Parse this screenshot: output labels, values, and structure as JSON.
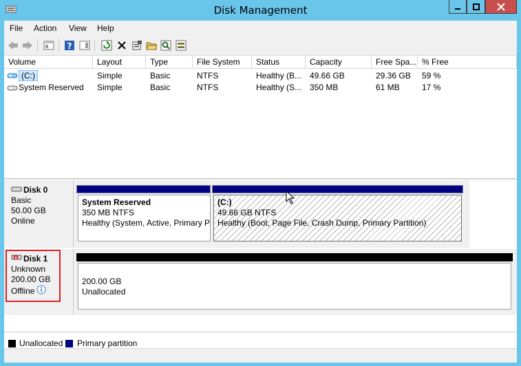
{
  "window": {
    "title": "Disk Management"
  },
  "menu": [
    {
      "label": "File"
    },
    {
      "label": "Action"
    },
    {
      "label": "View"
    },
    {
      "label": "Help"
    }
  ],
  "volume_list": {
    "columns": [
      "Volume",
      "Layout",
      "Type",
      "File System",
      "Status",
      "Capacity",
      "Free Spa...",
      "% Free"
    ],
    "rows": [
      {
        "volume": "(C:)",
        "layout": "Simple",
        "type": "Basic",
        "fs": "NTFS",
        "status": "Healthy (B...",
        "capacity": "49.66 GB",
        "free": "29.36 GB",
        "pct": "59 %"
      },
      {
        "volume": "System Reserved",
        "layout": "Simple",
        "type": "Basic",
        "fs": "NTFS",
        "status": "Healthy (S...",
        "capacity": "350 MB",
        "free": "61 MB",
        "pct": "17 %"
      }
    ]
  },
  "disks": [
    {
      "name": "Disk 0",
      "kind": "Basic",
      "size": "50.00 GB",
      "state": "Online",
      "partitions": [
        {
          "name": "System Reserved",
          "size": "350 MB NTFS",
          "status": "Healthy (System, Active, Primary P"
        },
        {
          "name": "(C:)",
          "size": "49.66 GB NTFS",
          "status": "Healthy (Boot, Page File, Crash Dump, Primary Partition)"
        }
      ]
    },
    {
      "name": "Disk 1",
      "kind": "Unknown",
      "size": "200.00 GB",
      "state": "Offline",
      "partitions": [
        {
          "size": "200.00 GB",
          "status": "Unallocated"
        }
      ]
    }
  ],
  "legend": [
    {
      "label": "Unallocated",
      "color": "#000000"
    },
    {
      "label": "Primary partition",
      "color": "#000080"
    }
  ],
  "colors": {
    "primary": "#000080",
    "unallocated": "#000000",
    "highlight": "#e02020",
    "titlebar": "#6ac5ea"
  }
}
